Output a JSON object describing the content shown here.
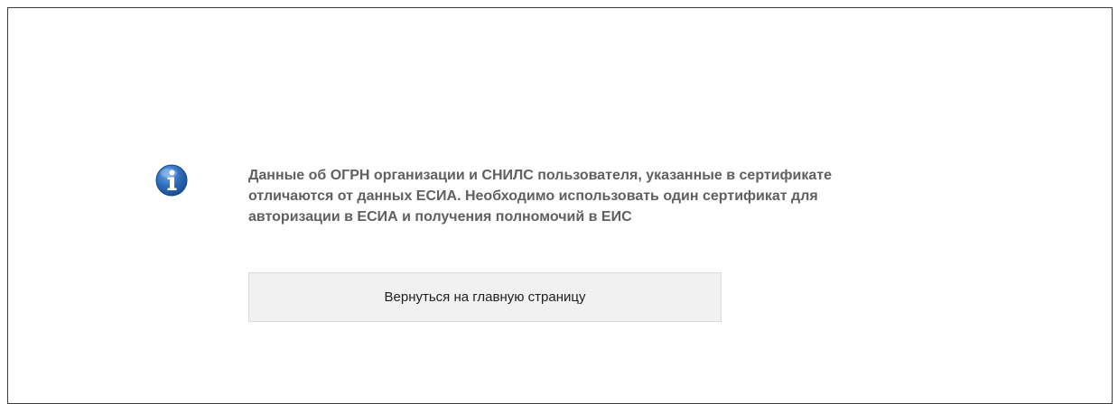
{
  "notice": {
    "icon": "info-icon",
    "icon_color": "#2f6fbd",
    "message_lines": [
      "Данные об ОГРН организации и СНИЛС пользователя, указанные в сертификате",
      "отличаются от данных ЕСИА. Необходимо использовать один сертификат для",
      "авторизации в ЕСИА и получения полномочий в ЕИС"
    ]
  },
  "actions": {
    "back_label": "Вернуться на главную страницу"
  }
}
